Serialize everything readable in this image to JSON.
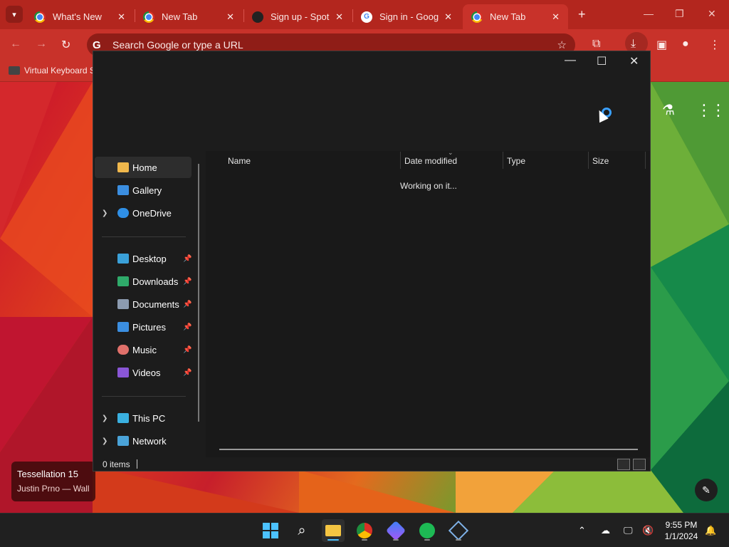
{
  "browser": {
    "tabs": [
      {
        "title": "What's New",
        "icon": "chrome-icon"
      },
      {
        "title": "New Tab",
        "icon": "chrome-icon"
      },
      {
        "title": "Sign up - Spotify",
        "icon": "spotify-icon"
      },
      {
        "title": "Sign in - Google",
        "icon": "google-icon"
      },
      {
        "title": "New Tab",
        "icon": "chrome-icon",
        "active": true
      }
    ],
    "omnibox_placeholder": "Search Google or type a URL",
    "bookmark": "Virtual Keyboard S",
    "accent_color": "#c8322a"
  },
  "ntp": {
    "credit_title": "Tessellation 15",
    "credit_author": "Justin Prno — Walli"
  },
  "explorer": {
    "nav": {
      "quick": [
        {
          "label": "Home",
          "icon": "home-icon",
          "selected": true
        },
        {
          "label": "Gallery",
          "icon": "gallery-icon"
        },
        {
          "label": "OneDrive",
          "icon": "onedrive-icon",
          "expandable": true
        }
      ],
      "pinned": [
        {
          "label": "Desktop",
          "icon": "desktop-icon"
        },
        {
          "label": "Downloads",
          "icon": "downloads-icon"
        },
        {
          "label": "Documents",
          "icon": "documents-icon"
        },
        {
          "label": "Pictures",
          "icon": "pictures-icon"
        },
        {
          "label": "Music",
          "icon": "music-icon"
        },
        {
          "label": "Videos",
          "icon": "videos-icon"
        }
      ],
      "devices": [
        {
          "label": "This PC",
          "icon": "this-pc-icon"
        },
        {
          "label": "Network",
          "icon": "network-icon"
        }
      ]
    },
    "columns": {
      "name": "Name",
      "date": "Date modified",
      "type": "Type",
      "size": "Size"
    },
    "loading_text": "Working on it...",
    "status": "0 items"
  },
  "taskbar": {
    "apps": [
      "start-icon",
      "search-icon",
      "file-explorer-icon",
      "chrome-icon",
      "copilot-icon",
      "spotify-icon",
      "virtualbox-icon"
    ],
    "time": "9:55 PM",
    "date": "1/1/2024"
  }
}
